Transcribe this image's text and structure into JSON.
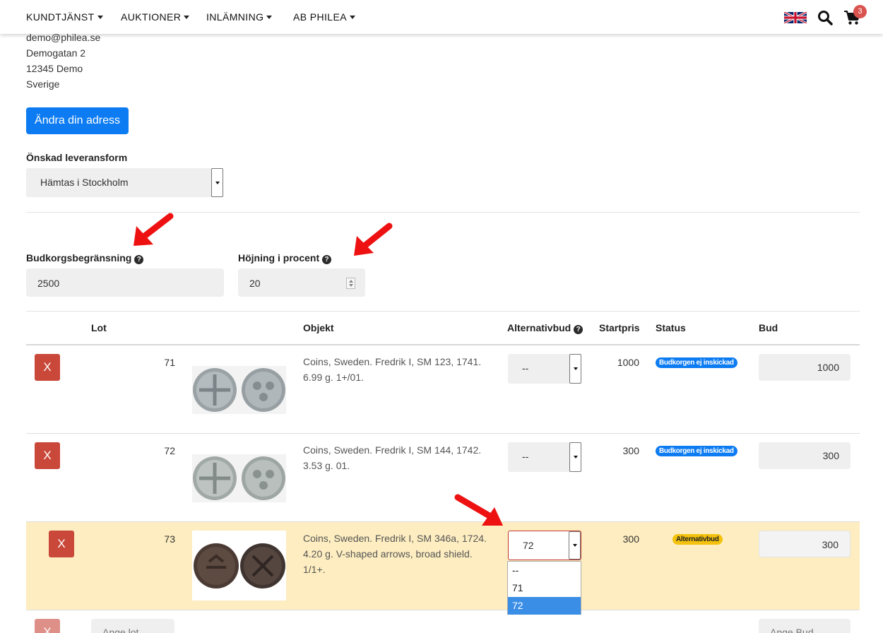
{
  "nav": {
    "items": [
      "KUNDTJÄNST",
      "AUKTIONER",
      "INLÄMNING",
      "AB PHILEA"
    ],
    "cart_count": "3"
  },
  "address": {
    "email": "demo@philea.se",
    "street": "Demogatan 2",
    "postal": "12345 Demo",
    "country": "Sverige"
  },
  "change_address_label": "Ändra din adress",
  "delivery": {
    "label": "Önskad leveransform",
    "value": "Hämtas i Stockholm"
  },
  "limit": {
    "label": "Budkorgsbegränsning",
    "value": "2500"
  },
  "increase": {
    "label": "Höjning i procent",
    "value": "20"
  },
  "table": {
    "headers": {
      "lot": "Lot",
      "objekt": "Objekt",
      "alt": "Alternativbud",
      "startpris": "Startpris",
      "status": "Status",
      "bud": "Bud"
    },
    "rows": [
      {
        "remove": "X",
        "lot": "71",
        "objekt": "Coins, Sweden. Fredrik I, SM 123, 1741. 6.99 g. 1+/01.",
        "alt": "--",
        "startpris": "1000",
        "status": "Budkorgen ej inskickad",
        "bud": "1000"
      },
      {
        "remove": "X",
        "lot": "72",
        "objekt": "Coins, Sweden. Fredrik I, SM 144, 1742. 3.53 g. 01.",
        "alt": "--",
        "startpris": "300",
        "status": "Budkorgen ej inskickad",
        "bud": "300"
      },
      {
        "remove": "X",
        "lot": "73",
        "objekt": "Coins, Sweden. Fredrik I, SM 346a, 1724. 4.20 g. V-shaped arrows, broad shield. 1/1+.",
        "alt": "72",
        "startpris": "300",
        "status": "Alternativbud",
        "bud": "300"
      }
    ],
    "dropdown_options": [
      "--",
      "71",
      "72"
    ],
    "new_row": {
      "remove": "X",
      "lot_placeholder": "Ange lot",
      "bud_placeholder": "Ange Bud"
    }
  },
  "colors": {
    "primary": "#0d7cf2",
    "danger": "#c9483a",
    "highlight_row": "#fdedc0",
    "badge_warning": "#f4c20d",
    "annotation_arrow": "#ee1111"
  }
}
